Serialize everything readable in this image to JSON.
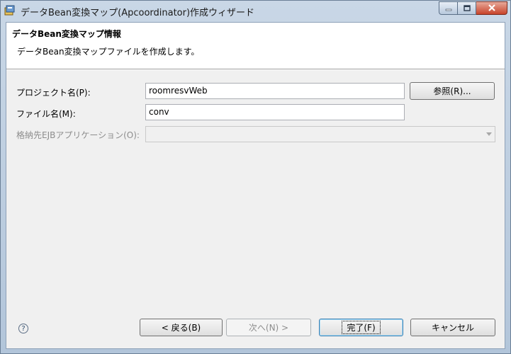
{
  "window": {
    "title": "データBean変換マップ(Apcoordinator)作成ウィザード"
  },
  "banner": {
    "title": "データBean変換マップ情報",
    "description": "データBean変換マップファイルを作成します。"
  },
  "form": {
    "project_label": "プロジェクト名(P):",
    "project_value": "roomresvWeb",
    "browse_label": "参照(R)...",
    "file_label": "ファイル名(M):",
    "file_value": "conv",
    "ejb_label": "格納先EJBアプリケーション(O):",
    "ejb_value": ""
  },
  "footer": {
    "help_glyph": "?",
    "back_label": "< 戻る(B)",
    "next_label": "次へ(N) >",
    "finish_label": "完了(F)",
    "cancel_label": "キャンセル"
  },
  "icons": {
    "app": "wizard-app-icon",
    "help": "help-icon",
    "minimize": "minimize-icon",
    "maximize": "maximize-icon",
    "close": "close-icon"
  }
}
